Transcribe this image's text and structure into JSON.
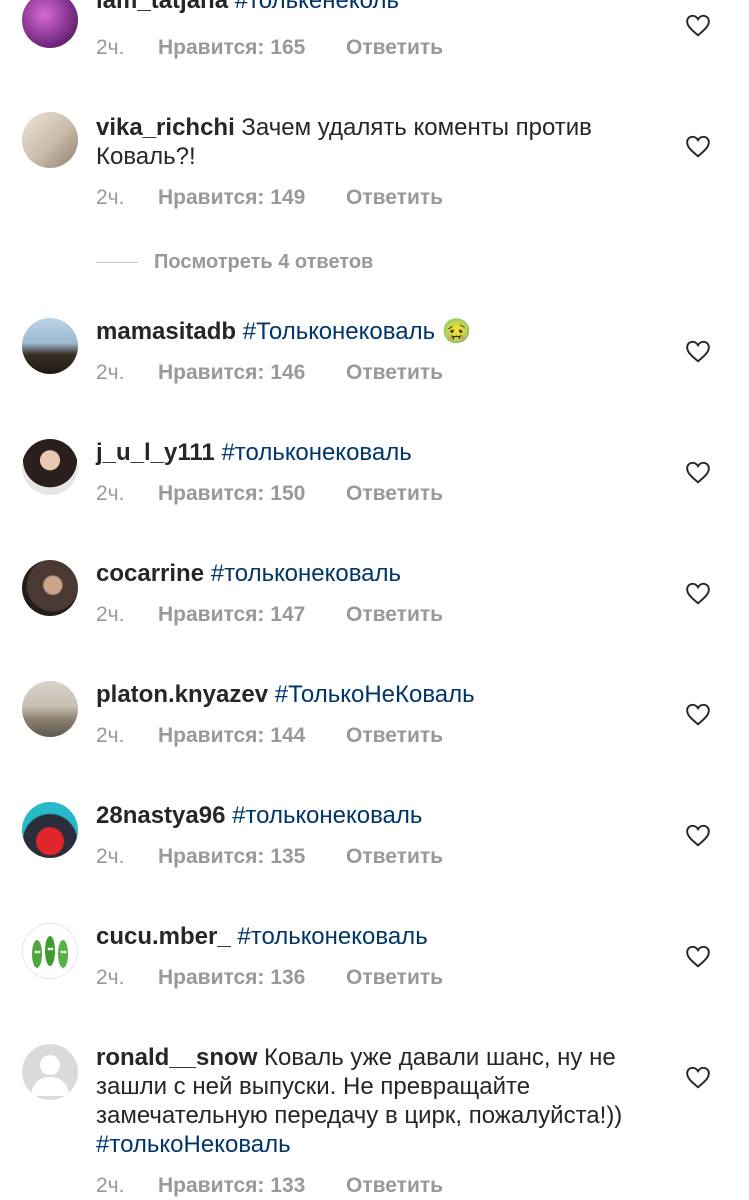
{
  "comments": [
    {
      "username": "iam_tatjana",
      "text": "#толькенеколь",
      "is_tag": true,
      "time": "2ч.",
      "likes": "Нравится: 165",
      "reply": "Ответить"
    },
    {
      "username": "vika_richchi",
      "text": "Зачем удалять коменты против Коваль?!",
      "is_tag": false,
      "time": "2ч.",
      "likes": "Нравится: 149",
      "reply": "Ответить"
    },
    {
      "username": "mamasitadb",
      "text": "#Толькoнековаль",
      "is_tag": true,
      "emoji": "🤢",
      "time": "2ч.",
      "likes": "Нравится: 146",
      "reply": "Ответить"
    },
    {
      "username": "j_u_l_y111",
      "text": "#толькoнековаль",
      "is_tag": true,
      "time": "2ч.",
      "likes": "Нравится: 150",
      "reply": "Ответить"
    },
    {
      "username": "cocarrine",
      "text": "#толькoнековаль",
      "is_tag": true,
      "time": "2ч.",
      "likes": "Нравится: 147",
      "reply": "Ответить"
    },
    {
      "username": "platon.knyazev",
      "text": "#ТолькоНеКоваль",
      "is_tag": true,
      "time": "2ч.",
      "likes": "Нравится: 144",
      "reply": "Ответить"
    },
    {
      "username": "28nastya96",
      "text": "#толькoнековаль",
      "is_tag": true,
      "time": "2ч.",
      "likes": "Нравится: 135",
      "reply": "Ответить"
    },
    {
      "username": "cucu.mber_",
      "text": "#толькoнековаль",
      "is_tag": true,
      "time": "2ч.",
      "likes": "Нравится: 136",
      "reply": "Ответить"
    },
    {
      "username": "ronald__snow",
      "text": "Коваль уже давали шанс, ну не зашли с ней выпуски. Не превращайте замечательную передачу в цирк, пожалуйста!))",
      "tag": "#толькоНековаль",
      "is_tag": false,
      "time": "2ч.",
      "likes": "Нравится: 133",
      "reply": "Ответить"
    }
  ],
  "view_replies": "Посмотреть 4 ответов",
  "icons": {
    "like": "heart-outline-icon"
  },
  "colors": {
    "text": "#262626",
    "hashtag": "#003569",
    "meta": "#999999"
  }
}
